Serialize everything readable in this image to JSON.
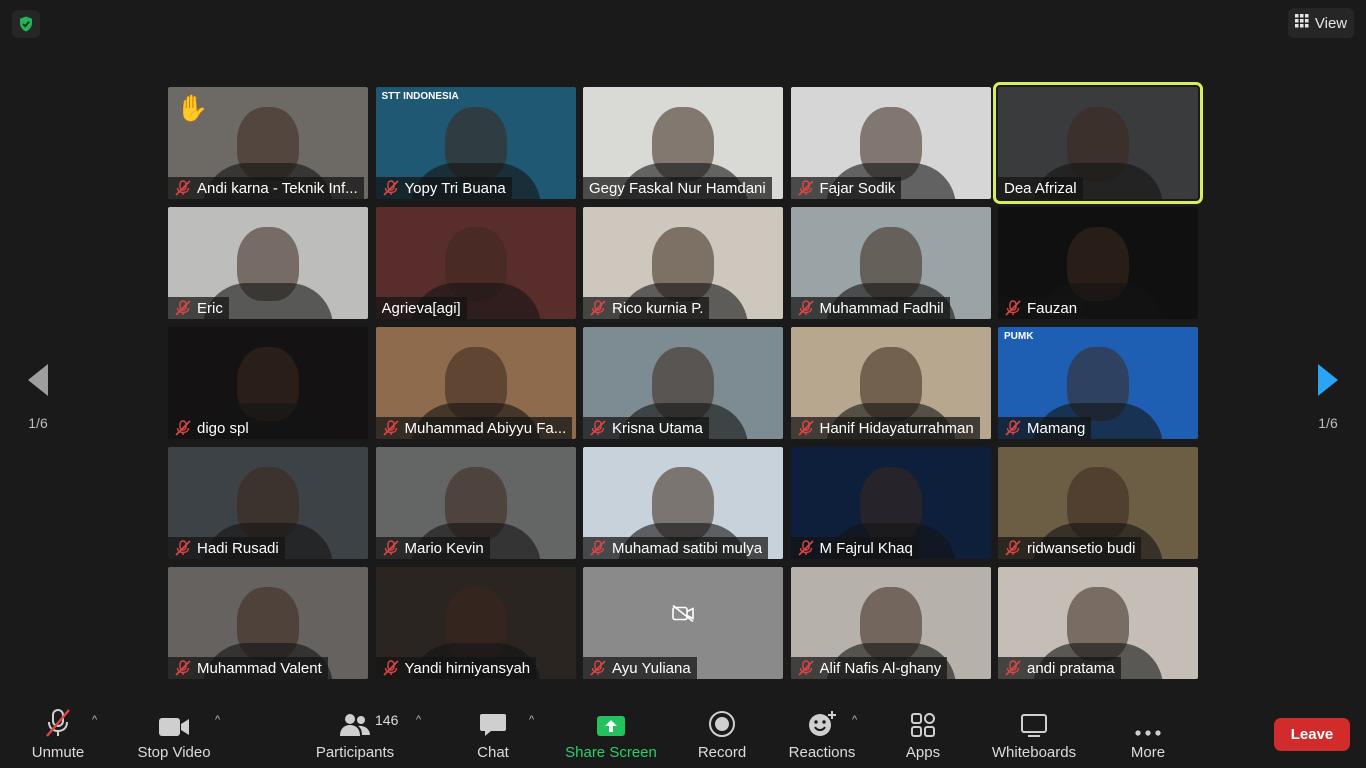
{
  "top": {
    "view_label": "View"
  },
  "nav": {
    "page_left": "1/6",
    "page_right": "1/6"
  },
  "participants_grid": [
    {
      "name": "Andi karna - Teknik Inf...",
      "muted": true,
      "hand_raised": true,
      "bg": "#6d6a66"
    },
    {
      "name": "Yopy Tri Buana",
      "muted": true,
      "bg": "#1f5872",
      "banner": "STT INDONESIA"
    },
    {
      "name": "Gegy Faskal Nur Hamdani",
      "muted": false,
      "bg": "#d9d9d6"
    },
    {
      "name": "Fajar Sodik",
      "muted": true,
      "bg": "#d6d6d6"
    },
    {
      "name": "Dea Afrizal",
      "muted": false,
      "active": true,
      "bg": "#3a3b3c"
    },
    {
      "name": "Eric",
      "muted": true,
      "bg": "#bdbdbc"
    },
    {
      "name": "Agrieva[agi]",
      "muted": false,
      "bg": "#5a2d2d"
    },
    {
      "name": "Rico kurnia P.",
      "muted": true,
      "bg": "#cdc7bd"
    },
    {
      "name": "Muhammad Fadhil",
      "muted": true,
      "bg": "#9aa4a6"
    },
    {
      "name": "Fauzan",
      "muted": true,
      "bg": "#101010"
    },
    {
      "name": "digo spl",
      "muted": true,
      "bg": "#141212"
    },
    {
      "name": "Muhammad Abiyyu Fa...",
      "muted": true,
      "bg": "#8d6b4c"
    },
    {
      "name": "Krisna Utama",
      "muted": true,
      "bg": "#7d8c92"
    },
    {
      "name": "Hanif Hidayaturrahman",
      "muted": true,
      "bg": "#b7a78e"
    },
    {
      "name": "Mamang",
      "muted": true,
      "bg": "#1f5fb3",
      "banner": "PUMK"
    },
    {
      "name": "Hadi Rusadi",
      "muted": true,
      "bg": "#3c4246"
    },
    {
      "name": "Mario Kevin",
      "muted": true,
      "bg": "#646565"
    },
    {
      "name": "Muhamad satibi mulya",
      "muted": true,
      "bg": "#c7d2da"
    },
    {
      "name": "M Fajrul Khaq",
      "muted": true,
      "bg": "#0d1f3a"
    },
    {
      "name": "ridwansetio budi",
      "muted": true,
      "bg": "#6b5e45"
    },
    {
      "name": "Muhammad Valent",
      "muted": true,
      "bg": "#66625f"
    },
    {
      "name": "Yandi hirniyansyah",
      "muted": true,
      "bg": "#2a2521"
    },
    {
      "name": "Ayu Yuliana",
      "muted": true,
      "bg": "#8a8a8a",
      "video_off": true
    },
    {
      "name": "Alif Nafis Al-ghany",
      "muted": true,
      "bg": "#b6b2ab"
    },
    {
      "name": "andi pratama",
      "muted": true,
      "bg": "#c4beb6"
    }
  ],
  "toolbar": {
    "unmute": "Unmute",
    "stop_video": "Stop Video",
    "participants": "Participants",
    "participants_count": "146",
    "chat": "Chat",
    "share_screen": "Share Screen",
    "record": "Record",
    "reactions": "Reactions",
    "apps": "Apps",
    "whiteboards": "Whiteboards",
    "more": "More",
    "leave": "Leave"
  },
  "colors": {
    "accent_green": "#2ad06a",
    "leave_red": "#d12b2b",
    "active_outline": "#d7ef5c",
    "arrow_blue": "#2aa4f4"
  },
  "icons": [
    "shield-check-icon",
    "grid-icon",
    "mic-muted-icon",
    "video-camera-icon",
    "participants-icon",
    "chat-bubble-icon",
    "share-screen-icon",
    "record-icon",
    "reactions-icon",
    "apps-icon",
    "whiteboard-icon",
    "more-icon",
    "chevron-left-icon",
    "chevron-right-icon",
    "raised-hand-icon",
    "video-off-icon"
  ]
}
